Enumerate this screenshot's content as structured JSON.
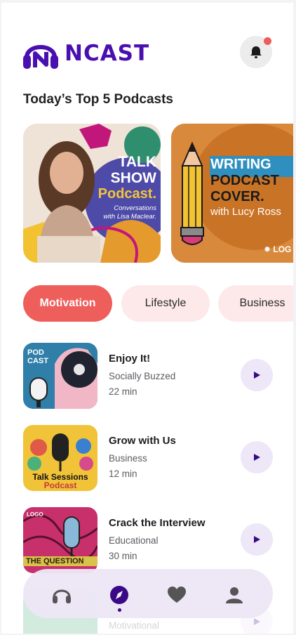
{
  "app": {
    "name": "NCAST"
  },
  "header": {
    "notification_badge": true
  },
  "section_title": "Today’s Top 5 Podcasts",
  "featured": [
    {
      "line1": "TALK",
      "line2": "SHOW",
      "line3": "Podcast.",
      "sub1": "Conversations",
      "sub2": "with Lisa Maclear."
    },
    {
      "line1": "WRITING",
      "line2": "PODCAST",
      "line3": "COVER.",
      "sub": "with Lucy Ross",
      "logo": "LOG"
    }
  ],
  "chips": [
    "Motivation",
    "Lifestyle",
    "Business"
  ],
  "active_chip": "Motivation",
  "episodes": [
    {
      "title": "Enjoy It!",
      "category": "Socially Buzzed",
      "duration": "22 min",
      "art_text": [
        "POD",
        "CAST"
      ]
    },
    {
      "title": "Grow with Us",
      "category": "Business",
      "duration": "12 min",
      "art_text": [
        "Talk Sessions",
        "Podcast"
      ]
    },
    {
      "title": "Crack the Interview",
      "category": "Educational",
      "duration": "30 min",
      "art_text": [
        "LOGO",
        "THE QUESTION"
      ]
    },
    {
      "title": "",
      "category": "Motivational",
      "duration": ""
    }
  ],
  "nav": [
    "headphones-icon",
    "compass-icon",
    "heart-icon",
    "user-icon"
  ],
  "colors": {
    "brand": "#4a0fb0",
    "accent": "#ee5e5b",
    "chip_bg": "#fde9ea",
    "play_bg": "#ede7f7"
  }
}
